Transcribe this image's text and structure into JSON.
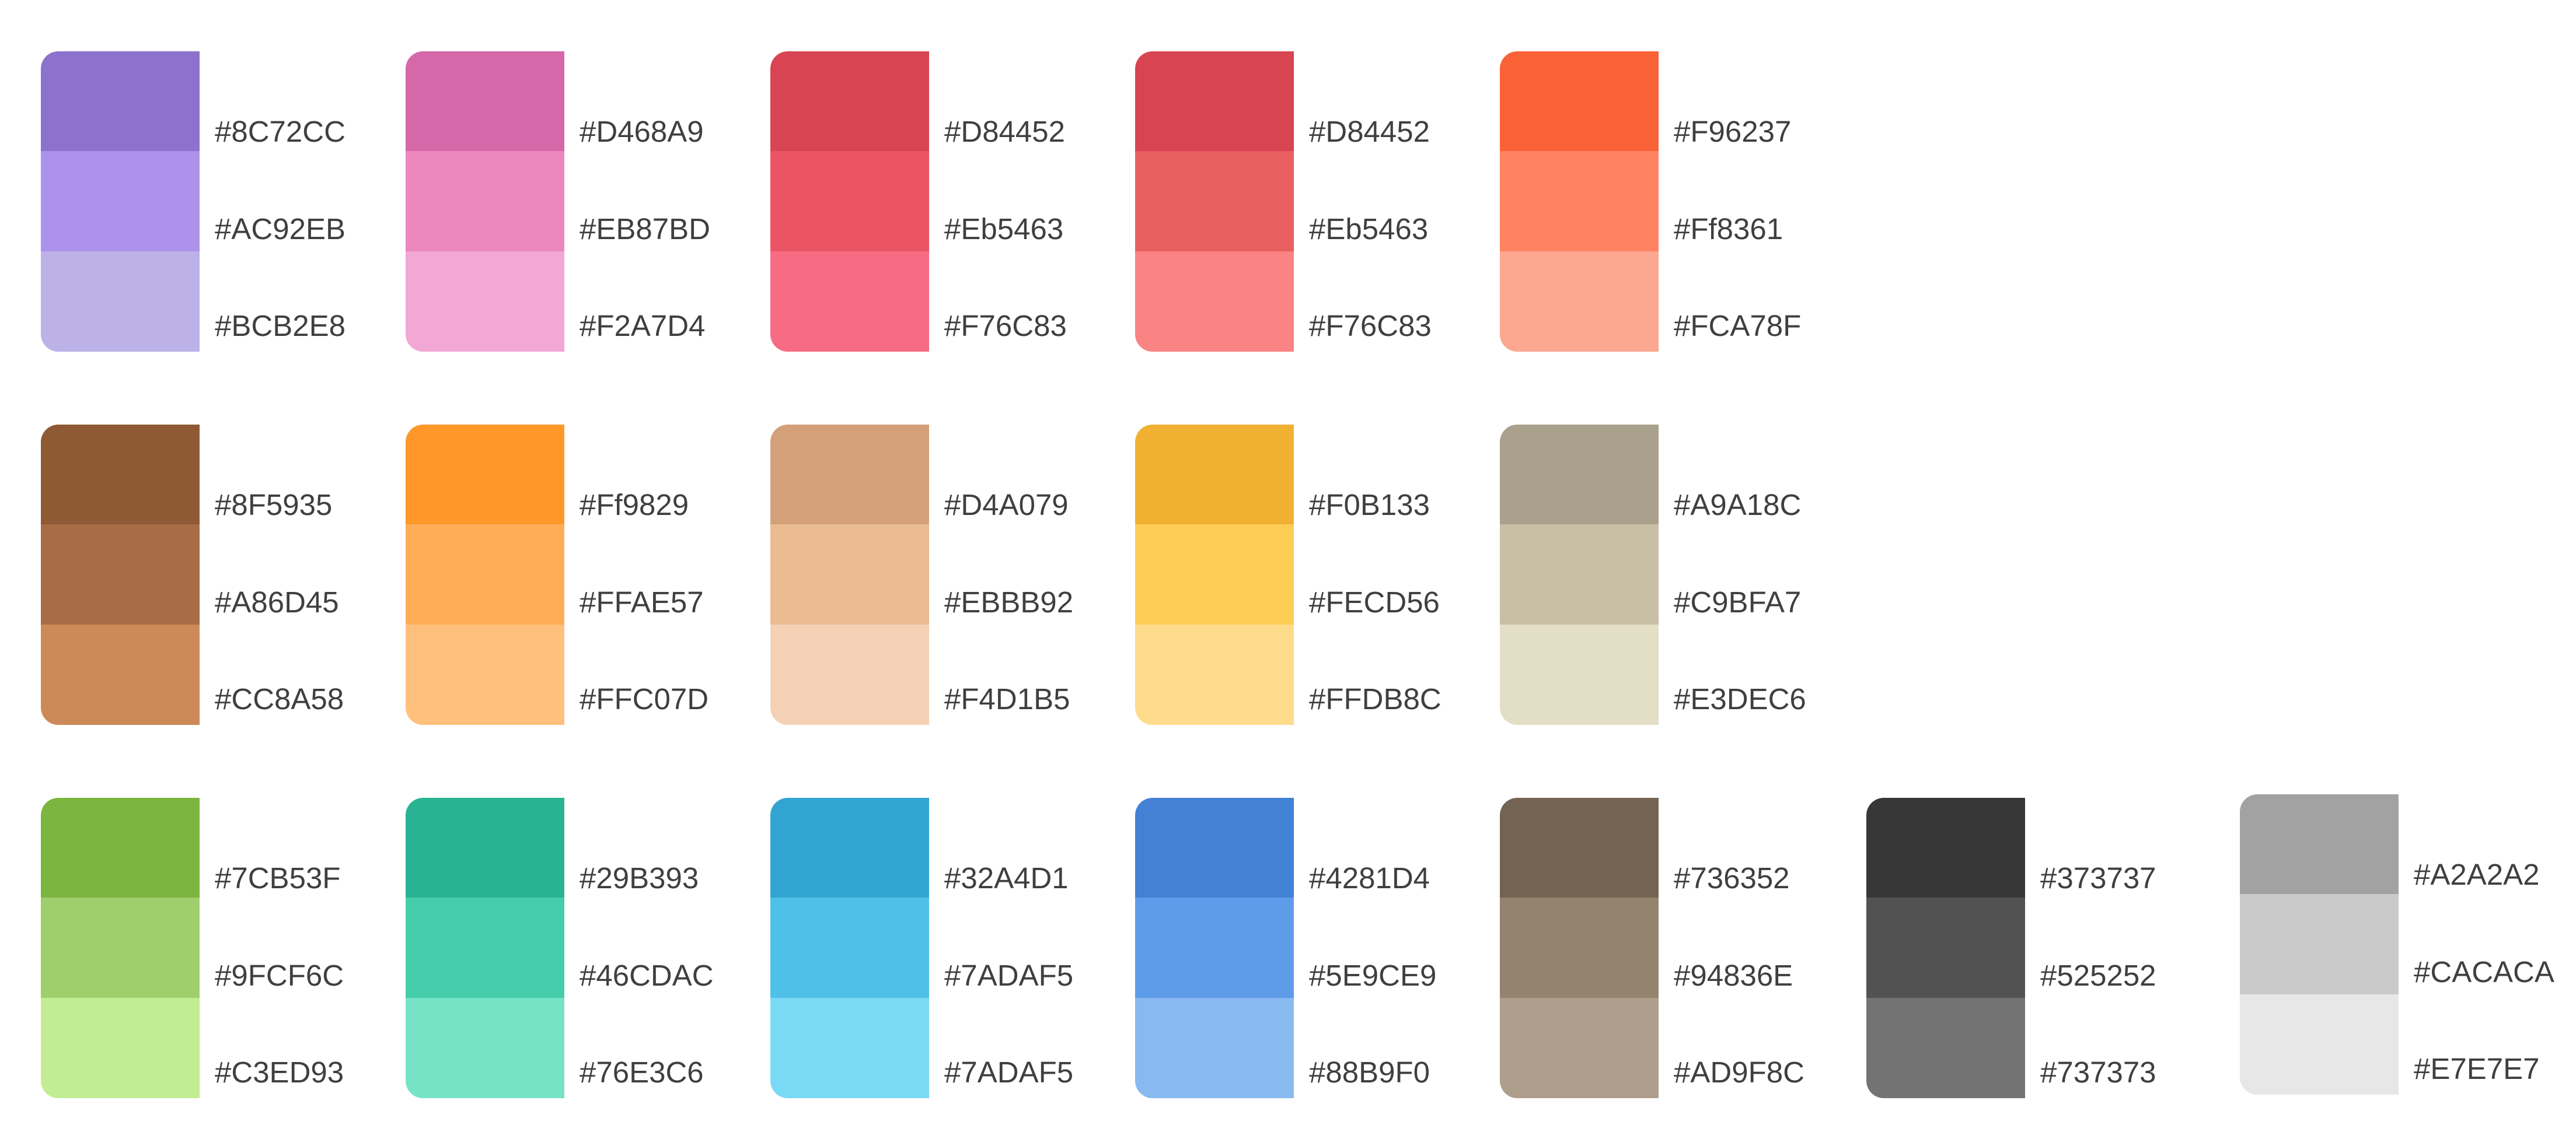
{
  "palettes": [
    [
      {
        "hex": "#8C72CC",
        "label": "#8C72CC"
      },
      {
        "hex": "#AC92EB",
        "label": "#AC92EB"
      },
      {
        "hex": "#BCB2E8",
        "label": "#BCB2E8"
      }
    ],
    [
      {
        "hex": "#D468A9",
        "label": "#D468A9"
      },
      {
        "hex": "#EB87BD",
        "label": "#EB87BD"
      },
      {
        "hex": "#F2A7D4",
        "label": "#F2A7D4"
      }
    ],
    [
      {
        "hex": "#D84452",
        "label": "#D84452"
      },
      {
        "hex": "#EB5463",
        "label": "#Eb5463"
      },
      {
        "hex": "#F76C83",
        "label": "#F76C83"
      }
    ],
    [
      {
        "hex": "#D84452",
        "label": "#D84452"
      },
      {
        "hex": "#E86060",
        "label": "#Eb5463"
      },
      {
        "hex": "#FA8383",
        "label": "#F76C83"
      }
    ],
    [
      {
        "hex": "#F96237",
        "label": "#F96237"
      },
      {
        "hex": "#FF8361",
        "label": "#Ff8361"
      },
      {
        "hex": "#FCA78F",
        "label": "#FCA78F"
      }
    ],
    [
      {
        "hex": "#8F5935",
        "label": "#8F5935"
      },
      {
        "hex": "#A86D45",
        "label": "#A86D45"
      },
      {
        "hex": "#CC8A58",
        "label": "#CC8A58"
      }
    ],
    [
      {
        "hex": "#FF9829",
        "label": "#Ff9829"
      },
      {
        "hex": "#FFAE57",
        "label": "#FFAE57"
      },
      {
        "hex": "#FFC07D",
        "label": "#FFC07D"
      }
    ],
    [
      {
        "hex": "#D4A079",
        "label": "#D4A079"
      },
      {
        "hex": "#EBBB92",
        "label": "#EBBB92"
      },
      {
        "hex": "#F4D1B5",
        "label": "#F4D1B5"
      }
    ],
    [
      {
        "hex": "#F0B133",
        "label": "#F0B133"
      },
      {
        "hex": "#FECD56",
        "label": "#FECD56"
      },
      {
        "hex": "#FFDB8C",
        "label": "#FFDB8C"
      }
    ],
    [
      {
        "hex": "#A9A18C",
        "label": "#A9A18C"
      },
      {
        "hex": "#C9BFA7",
        "label": "#C9BFA7"
      },
      {
        "hex": "#E3DEC6",
        "label": "#E3DEC6"
      }
    ],
    [
      {
        "hex": "#7CB53F",
        "label": "#7CB53F"
      },
      {
        "hex": "#9FCF6C",
        "label": "#9FCF6C"
      },
      {
        "hex": "#C3ED93",
        "label": "#C3ED93"
      }
    ],
    [
      {
        "hex": "#29B393",
        "label": "#29B393"
      },
      {
        "hex": "#46CDAC",
        "label": "#46CDAC"
      },
      {
        "hex": "#76E3C6",
        "label": "#76E3C6"
      }
    ],
    [
      {
        "hex": "#32A4D1",
        "label": "#32A4D1"
      },
      {
        "hex": "#4FC1E8",
        "label": "#7ADAF5"
      },
      {
        "hex": "#7ADAF5",
        "label": "#7ADAF5"
      }
    ],
    [
      {
        "hex": "#4281D4",
        "label": "#4281D4"
      },
      {
        "hex": "#5E9CE9",
        "label": "#5E9CE9"
      },
      {
        "hex": "#88B9F0",
        "label": "#88B9F0"
      }
    ],
    [
      {
        "hex": "#736352",
        "label": "#736352"
      },
      {
        "hex": "#94836E",
        "label": "#94836E"
      },
      {
        "hex": "#AD9F8C",
        "label": "#AD9F8C"
      }
    ],
    [
      {
        "hex": "#373737",
        "label": "#373737"
      },
      {
        "hex": "#525252",
        "label": "#525252"
      },
      {
        "hex": "#737373",
        "label": "#737373"
      }
    ],
    [
      {
        "hex": "#A2A2A2",
        "label": "#A2A2A2"
      },
      {
        "hex": "#CACACA",
        "label": "#CACACA"
      },
      {
        "hex": "#E7E7E7",
        "label": "#E7E7E7"
      }
    ]
  ]
}
